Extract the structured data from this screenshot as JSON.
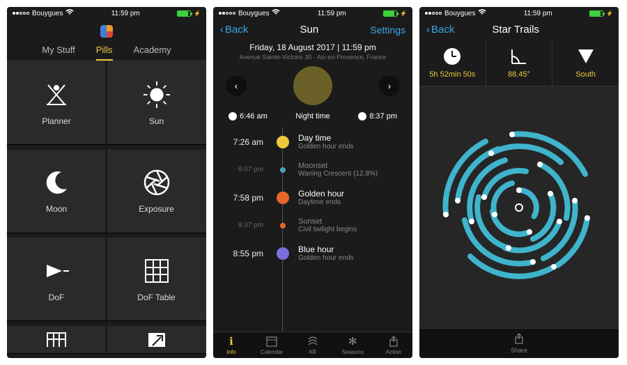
{
  "status": {
    "carrier": "Bouygues",
    "time": "11:59 pm"
  },
  "phone1": {
    "tabs": [
      "My Stuff",
      "Pills",
      "Academy"
    ],
    "active_tab": "Pills",
    "cells": [
      {
        "label": "Planner",
        "icon": "planner"
      },
      {
        "label": "Sun",
        "icon": "sun"
      },
      {
        "label": "Moon",
        "icon": "moon"
      },
      {
        "label": "Exposure",
        "icon": "exposure"
      },
      {
        "label": "DoF",
        "icon": "dof"
      },
      {
        "label": "DoF Table",
        "icon": "dof-table"
      }
    ]
  },
  "phone2": {
    "back": "Back",
    "title": "Sun",
    "settings": "Settings",
    "date_main": "Friday, 18 August 2017 | 11:59 pm",
    "date_sub": "Avenue Sainte-Victoire 30 · Aix-en-Provence, France",
    "sunrise": "6:46 am",
    "night_label": "Night time",
    "sunset": "8:37 pm",
    "timeline": [
      {
        "time": "7:26 am",
        "title": "Day time",
        "sub": "Golden hour ends",
        "color": "#edc93c",
        "dim": false
      },
      {
        "time": "6:07 pm",
        "title": "Moonset",
        "sub": "Waning Crescent (12.8%)",
        "color": "#4aa3b8",
        "dim": true
      },
      {
        "time": "7:58 pm",
        "title": "Golden hour",
        "sub": "Daytime ends",
        "color": "#e8672c",
        "dim": false
      },
      {
        "time": "8:37 pm",
        "title": "Sunset",
        "sub": "Civil twilight begins",
        "color": "#e8672c",
        "dim": true
      },
      {
        "time": "8:55 pm",
        "title": "Blue hour",
        "sub": "Golden hour ends",
        "color": "#7b6fd8",
        "dim": false
      }
    ],
    "bottom_tabs": [
      {
        "label": "Info",
        "active": true
      },
      {
        "label": "Calendar",
        "active": false
      },
      {
        "label": "AR",
        "active": false
      },
      {
        "label": "Seasons",
        "active": false
      },
      {
        "label": "Action",
        "active": false
      }
    ]
  },
  "phone3": {
    "back": "Back",
    "title": "Star Trails",
    "metrics": [
      {
        "icon": "clock",
        "value": "5h 52min 50s"
      },
      {
        "icon": "angle",
        "value": "88.45°"
      },
      {
        "icon": "direction",
        "value": "South"
      }
    ],
    "share": "Share"
  }
}
